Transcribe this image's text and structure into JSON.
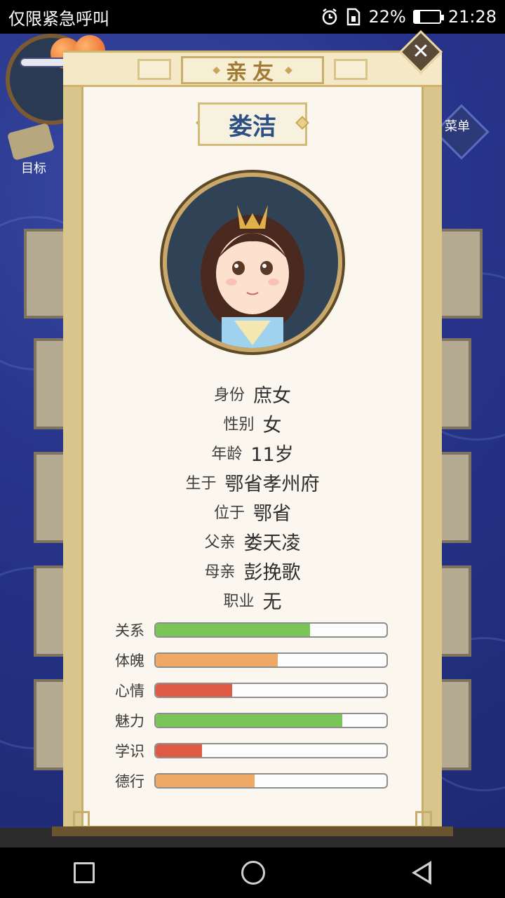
{
  "status_bar": {
    "carrier": "仅限紧急呼叫",
    "battery_percent": "22%",
    "battery_level": 0.22,
    "time": "21:28"
  },
  "background": {
    "target_label": "目标",
    "menu_label": "菜单"
  },
  "panel": {
    "title": "亲友",
    "name": "娄洁"
  },
  "info": [
    {
      "label": "身份",
      "value": "庶女"
    },
    {
      "label": "性别",
      "value": "女"
    },
    {
      "label": "年龄",
      "value": "11岁"
    },
    {
      "label": "生于",
      "value": "鄂省孝州府"
    },
    {
      "label": "位于",
      "value": "鄂省"
    },
    {
      "label": "父亲",
      "value": "娄天凌"
    },
    {
      "label": "母亲",
      "value": "彭挽歌"
    },
    {
      "label": "职业",
      "value": "无"
    }
  ],
  "stats": [
    {
      "label": "关系",
      "level": 0.67,
      "color": "#7ac557"
    },
    {
      "label": "体魄",
      "level": 0.53,
      "color": "#f0a867"
    },
    {
      "label": "心情",
      "level": 0.33,
      "color": "#e15a45"
    },
    {
      "label": "魅力",
      "level": 0.81,
      "color": "#7ac557"
    },
    {
      "label": "学识",
      "level": 0.2,
      "color": "#e15a45"
    },
    {
      "label": "德行",
      "level": 0.43,
      "color": "#f0a867"
    }
  ],
  "colors": {
    "panel_bg": "#fbf7ee",
    "title_color": "#a17c36",
    "name_color": "#2c4f86"
  },
  "icons": {
    "close": "close-icon",
    "alarm": "alarm-icon",
    "battery": "battery-icon"
  }
}
